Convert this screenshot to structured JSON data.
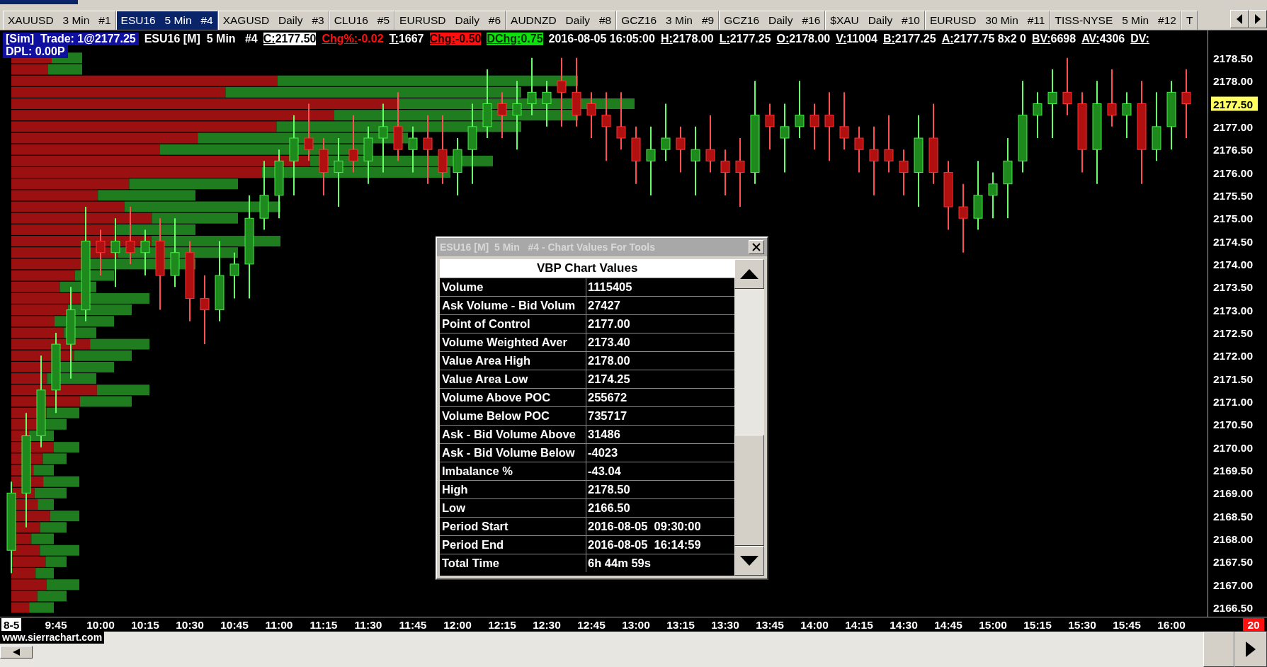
{
  "tabs": [
    {
      "label": "XAUUSD   3 Min   #1",
      "selected": false
    },
    {
      "label": "ESU16   5 Min   #4",
      "selected": true
    },
    {
      "label": "XAGUSD   Daily   #3",
      "selected": false
    },
    {
      "label": "CLU16   #5",
      "selected": false
    },
    {
      "label": "EURUSD   Daily   #6",
      "selected": false
    },
    {
      "label": "AUDNZD   Daily   #8",
      "selected": false
    },
    {
      "label": "GCZ16   3 Min   #9",
      "selected": false
    },
    {
      "label": "GCZ16   Daily   #16",
      "selected": false
    },
    {
      "label": "$XAU   Daily   #10",
      "selected": false
    },
    {
      "label": "EURUSD   30 Min   #11",
      "selected": false
    },
    {
      "label": "TISS-NYSE   5 Min   #12",
      "selected": false
    },
    {
      "label": "T",
      "selected": false
    }
  ],
  "info_bar": [
    {
      "kind": "badge",
      "text": "[Sim]  Trade: 1@2177.25"
    },
    {
      "kind": "plain",
      "text": "ESU16 [M]  5 Min   #4"
    },
    {
      "kind": "close",
      "label": "C:",
      "value": "2177.50"
    },
    {
      "kind": "percent",
      "label": "Chg%:",
      "value": "-0.02"
    },
    {
      "kind": "field",
      "label": "T:",
      "value": "1667"
    },
    {
      "kind": "change",
      "label": "Chg:",
      "value": "-0.50"
    },
    {
      "kind": "daily",
      "label": "DChg:",
      "value": "0.75"
    },
    {
      "kind": "plain",
      "text": "2016-08-05 16:05:00"
    },
    {
      "kind": "field",
      "label": "H:",
      "value": "2178.00"
    },
    {
      "kind": "field",
      "label": "L:",
      "value": "2177.25"
    },
    {
      "kind": "field",
      "label": "O:",
      "value": "2178.00"
    },
    {
      "kind": "field",
      "label": "V:",
      "value": "11004"
    },
    {
      "kind": "field",
      "label": "B:",
      "value": "2177.25"
    },
    {
      "kind": "field",
      "label": "A:",
      "value": "2177.75 8x2 0"
    },
    {
      "kind": "field",
      "label": "BV:",
      "value": "6698"
    },
    {
      "kind": "field",
      "label": "AV:",
      "value": "4306"
    },
    {
      "kind": "field",
      "label": "DV:"
    }
  ],
  "info_line_2": "DPL: 0.00P",
  "chart_data": {
    "type": "candlestick",
    "categories": [
      null,
      null,
      null,
      "9:45",
      null,
      null,
      "10:00",
      null,
      null,
      "10:15",
      null,
      null,
      "10:30",
      null,
      null,
      "10:45",
      null,
      null,
      "11:00",
      null,
      null,
      "11:15",
      null,
      null,
      "11:30",
      null,
      null,
      "11:45",
      null,
      null,
      "12:00",
      null,
      null,
      "12:15",
      null,
      null,
      "12:30",
      null,
      null,
      "12:45",
      null,
      null,
      "13:00",
      null,
      null,
      "13:15",
      null,
      null,
      "13:30",
      null,
      null,
      "13:45",
      null,
      null,
      "14:00",
      null,
      null,
      "14:15",
      null,
      null,
      "14:30",
      null,
      null,
      "14:45",
      null,
      null,
      "15:00",
      null,
      null,
      "15:15",
      null,
      null,
      "15:30",
      null,
      null,
      "15:45",
      null,
      null,
      "16:00",
      null
    ],
    "ohlc": [
      [
        2167.75,
        2169.25,
        2167.25,
        2169
      ],
      [
        2169,
        2170.75,
        2168.25,
        2170.25
      ],
      [
        2170.25,
        2172,
        2170,
        2171.25
      ],
      [
        2171.25,
        2172.5,
        2170.75,
        2172.25
      ],
      [
        2172.25,
        2173.5,
        2171.5,
        2173
      ],
      [
        2173,
        2175.25,
        2172.75,
        2174.5
      ],
      [
        2174.5,
        2174.75,
        2173.75,
        2174.25
      ],
      [
        2174.25,
        2175,
        2173.5,
        2174.5
      ],
      [
        2174.5,
        2175.25,
        2174,
        2174.25
      ],
      [
        2174.25,
        2174.75,
        2173.75,
        2174.5
      ],
      [
        2174.5,
        2175,
        2173,
        2173.75
      ],
      [
        2173.75,
        2175,
        2173.5,
        2174.25
      ],
      [
        2174.25,
        2174.5,
        2172.75,
        2173.25
      ],
      [
        2173.25,
        2173.75,
        2172.25,
        2173
      ],
      [
        2173,
        2174.5,
        2172.75,
        2173.75
      ],
      [
        2173.75,
        2174.25,
        2173.25,
        2174
      ],
      [
        2174,
        2175.5,
        2173.25,
        2175
      ],
      [
        2175,
        2176.25,
        2174.75,
        2175.5
      ],
      [
        2175.5,
        2176.5,
        2175,
        2176.25
      ],
      [
        2176.25,
        2177.25,
        2175.5,
        2176.75
      ],
      [
        2176.75,
        2177.5,
        2176.25,
        2176.5
      ],
      [
        2176.5,
        2176.75,
        2175.5,
        2176
      ],
      [
        2176,
        2176.75,
        2175.25,
        2176.25
      ],
      [
        2176.5,
        2177.25,
        2176,
        2176.25
      ],
      [
        2176.25,
        2177,
        2175.75,
        2176.75
      ],
      [
        2176.75,
        2177.5,
        2176,
        2177
      ],
      [
        2177,
        2177.75,
        2176.25,
        2176.5
      ],
      [
        2176.5,
        2177,
        2176,
        2176.75
      ],
      [
        2176.75,
        2177.25,
        2175.75,
        2176.5
      ],
      [
        2176.5,
        2177.25,
        2175.75,
        2176
      ],
      [
        2176,
        2176.75,
        2175.5,
        2176.5
      ],
      [
        2176.5,
        2177.5,
        2175.75,
        2177
      ],
      [
        2177,
        2178.25,
        2176.75,
        2177.5
      ],
      [
        2177.5,
        2177.75,
        2176.75,
        2177.25
      ],
      [
        2177.25,
        2178,
        2176.5,
        2177.5
      ],
      [
        2177.5,
        2178.5,
        2177.25,
        2177.75
      ],
      [
        2177.5,
        2178,
        2177,
        2177.75
      ],
      [
        2178,
        2178.5,
        2177,
        2177.75
      ],
      [
        2177.75,
        2178.5,
        2177,
        2177.25
      ],
      [
        2177.5,
        2177.75,
        2176.75,
        2177.25
      ],
      [
        2177.25,
        2177.75,
        2176.25,
        2177
      ],
      [
        2177,
        2177.75,
        2176.5,
        2176.75
      ],
      [
        2176.75,
        2177,
        2175.75,
        2176.25
      ],
      [
        2176.25,
        2177,
        2175.5,
        2176.5
      ],
      [
        2176.5,
        2177.5,
        2176.25,
        2176.75
      ],
      [
        2176.75,
        2177,
        2176,
        2176.5
      ],
      [
        2176.25,
        2177,
        2175.5,
        2176.5
      ],
      [
        2176.5,
        2177.25,
        2176,
        2176.25
      ],
      [
        2176.25,
        2176.5,
        2175.5,
        2176
      ],
      [
        2176.25,
        2176.75,
        2175.25,
        2176
      ],
      [
        2176,
        2178,
        2175.75,
        2177.25
      ],
      [
        2177.25,
        2177.5,
        2176.5,
        2177
      ],
      [
        2176.75,
        2177.5,
        2176,
        2177
      ],
      [
        2177,
        2178,
        2176.75,
        2177.25
      ],
      [
        2177.25,
        2177.5,
        2176.5,
        2177
      ],
      [
        2177.25,
        2177.75,
        2176.25,
        2177
      ],
      [
        2177,
        2177.75,
        2176.5,
        2176.75
      ],
      [
        2176.75,
        2177,
        2176,
        2176.5
      ],
      [
        2176.5,
        2177,
        2175.5,
        2176.25
      ],
      [
        2176.5,
        2177.25,
        2176,
        2176.25
      ],
      [
        2176.25,
        2176.5,
        2175.5,
        2176
      ],
      [
        2176,
        2177.25,
        2175.25,
        2176.75
      ],
      [
        2176.75,
        2177.5,
        2175.75,
        2176
      ],
      [
        2176,
        2176.25,
        2174.75,
        2175.25
      ],
      [
        2175.25,
        2175.75,
        2174.25,
        2175
      ],
      [
        2175,
        2176.25,
        2174.75,
        2175.5
      ],
      [
        2175.5,
        2176,
        2175,
        2175.75
      ],
      [
        2175.75,
        2176.75,
        2175,
        2176.25
      ],
      [
        2176.25,
        2178,
        2176,
        2177.25
      ],
      [
        2177.25,
        2177.75,
        2176.75,
        2177.5
      ],
      [
        2177.5,
        2178.25,
        2176.75,
        2177.75
      ],
      [
        2177.75,
        2178.5,
        2177.25,
        2177.5
      ],
      [
        2177.5,
        2177.75,
        2176,
        2176.5
      ],
      [
        2176.5,
        2178,
        2175.75,
        2177.5
      ],
      [
        2177.5,
        2178.25,
        2177,
        2177.25
      ],
      [
        2177.25,
        2177.75,
        2176.75,
        2177.5
      ],
      [
        2177.5,
        2178,
        2175.75,
        2176.5
      ],
      [
        2176.5,
        2177.75,
        2176.25,
        2177
      ],
      [
        2177,
        2178,
        2176.5,
        2177.75
      ],
      [
        2177.75,
        2178.25,
        2176.75,
        2177.5
      ]
    ],
    "ylim": [
      2166.3,
      2179.1
    ],
    "yticks": [
      {
        "value": 2178.5,
        "label": "2178.50"
      },
      {
        "value": 2178,
        "label": "2178.00"
      },
      {
        "value": 2177.5,
        "label": "2177.50"
      },
      {
        "value": 2177,
        "label": "2177.00"
      },
      {
        "value": 2176.5,
        "label": "2176.50"
      },
      {
        "value": 2176,
        "label": "2176.00"
      },
      {
        "value": 2175.5,
        "label": "2175.50"
      },
      {
        "value": 2175,
        "label": "2175.00"
      },
      {
        "value": 2174.5,
        "label": "2174.50"
      },
      {
        "value": 2174,
        "label": "2174.00"
      },
      {
        "value": 2173.5,
        "label": "2173.50"
      },
      {
        "value": 2173,
        "label": "2173.00"
      },
      {
        "value": 2172.5,
        "label": "2172.50"
      },
      {
        "value": 2172,
        "label": "2172.00"
      },
      {
        "value": 2171.5,
        "label": "2171.50"
      },
      {
        "value": 2171,
        "label": "2171.00"
      },
      {
        "value": 2170.5,
        "label": "2170.50"
      },
      {
        "value": 2170,
        "label": "2170.00"
      },
      {
        "value": 2169.5,
        "label": "2169.50"
      },
      {
        "value": 2169,
        "label": "2169.00"
      },
      {
        "value": 2168.5,
        "label": "2168.50"
      },
      {
        "value": 2168,
        "label": "2168.00"
      },
      {
        "value": 2167.5,
        "label": "2167.50"
      },
      {
        "value": 2167,
        "label": "2167.00"
      },
      {
        "value": 2166.5,
        "label": "2166.50"
      }
    ]
  },
  "date_label": "8-5",
  "bar_count": "20",
  "dialog": {
    "title": "ESU16 [M]  5 Min   #4 - Chart Values For Tools",
    "heading": "VBP Chart Values",
    "rows": [
      {
        "label": "Volume",
        "value": "1115405"
      },
      {
        "label": "Ask Volume - Bid Volum",
        "value": "27427"
      },
      {
        "label": "Point of Control",
        "value": "2177.00"
      },
      {
        "label": "Volume Weighted Aver",
        "value": "2173.40"
      },
      {
        "label": "Value Area High",
        "value": "2178.00"
      },
      {
        "label": "Value Area Low",
        "value": "2174.25"
      },
      {
        "label": "Volume Above POC",
        "value": "255672"
      },
      {
        "label": "Volume Below POC",
        "value": "735717"
      },
      {
        "label": "Ask - Bid Volume Above",
        "value": "31486"
      },
      {
        "label": "Ask - Bid Volume Below",
        "value": "-4023"
      },
      {
        "label": "Imbalance %",
        "value": "-43.04"
      },
      {
        "label": "High",
        "value": "2178.50"
      },
      {
        "label": "Low",
        "value": "2166.50"
      },
      {
        "label": "Period Start",
        "value": "2016-08-05  09:30:00"
      },
      {
        "label": "Period End",
        "value": "2016-08-05  16:14:59"
      },
      {
        "label": "Total Time",
        "value": "6h 44m 59s"
      }
    ]
  },
  "footer": {
    "website": "www.sierrachart.com"
  }
}
